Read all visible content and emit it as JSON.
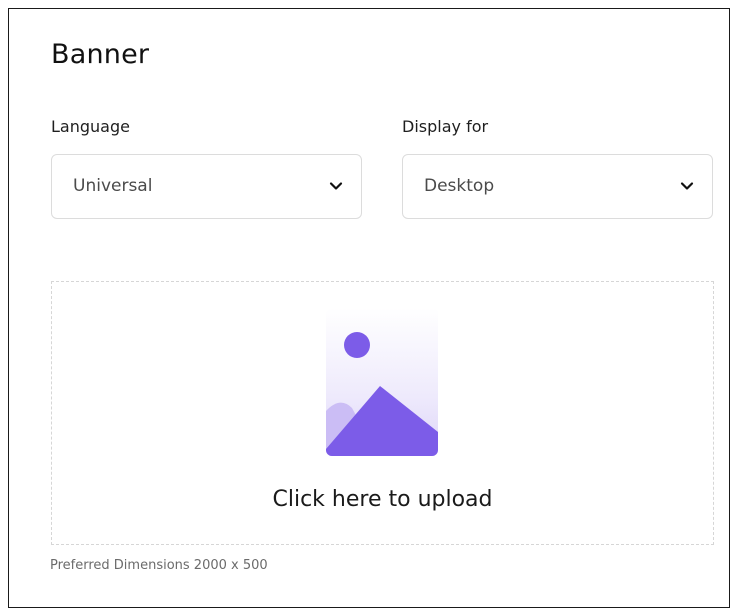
{
  "panel": {
    "title": "Banner",
    "language": {
      "label": "Language",
      "value": "Universal"
    },
    "display_for": {
      "label": "Display for",
      "value": "Desktop"
    },
    "upload": {
      "label": "Click here to upload",
      "hint": "Preferred Dimensions 2000 x 500"
    }
  },
  "colors": {
    "accent": "#7c5ce8",
    "accent_light": "#cbbdf5",
    "text": "#1a1a1a",
    "border": "#dcdcdc"
  },
  "icons": {
    "select_arrow": "chevron-down-icon",
    "upload": "image-upload-icon"
  }
}
